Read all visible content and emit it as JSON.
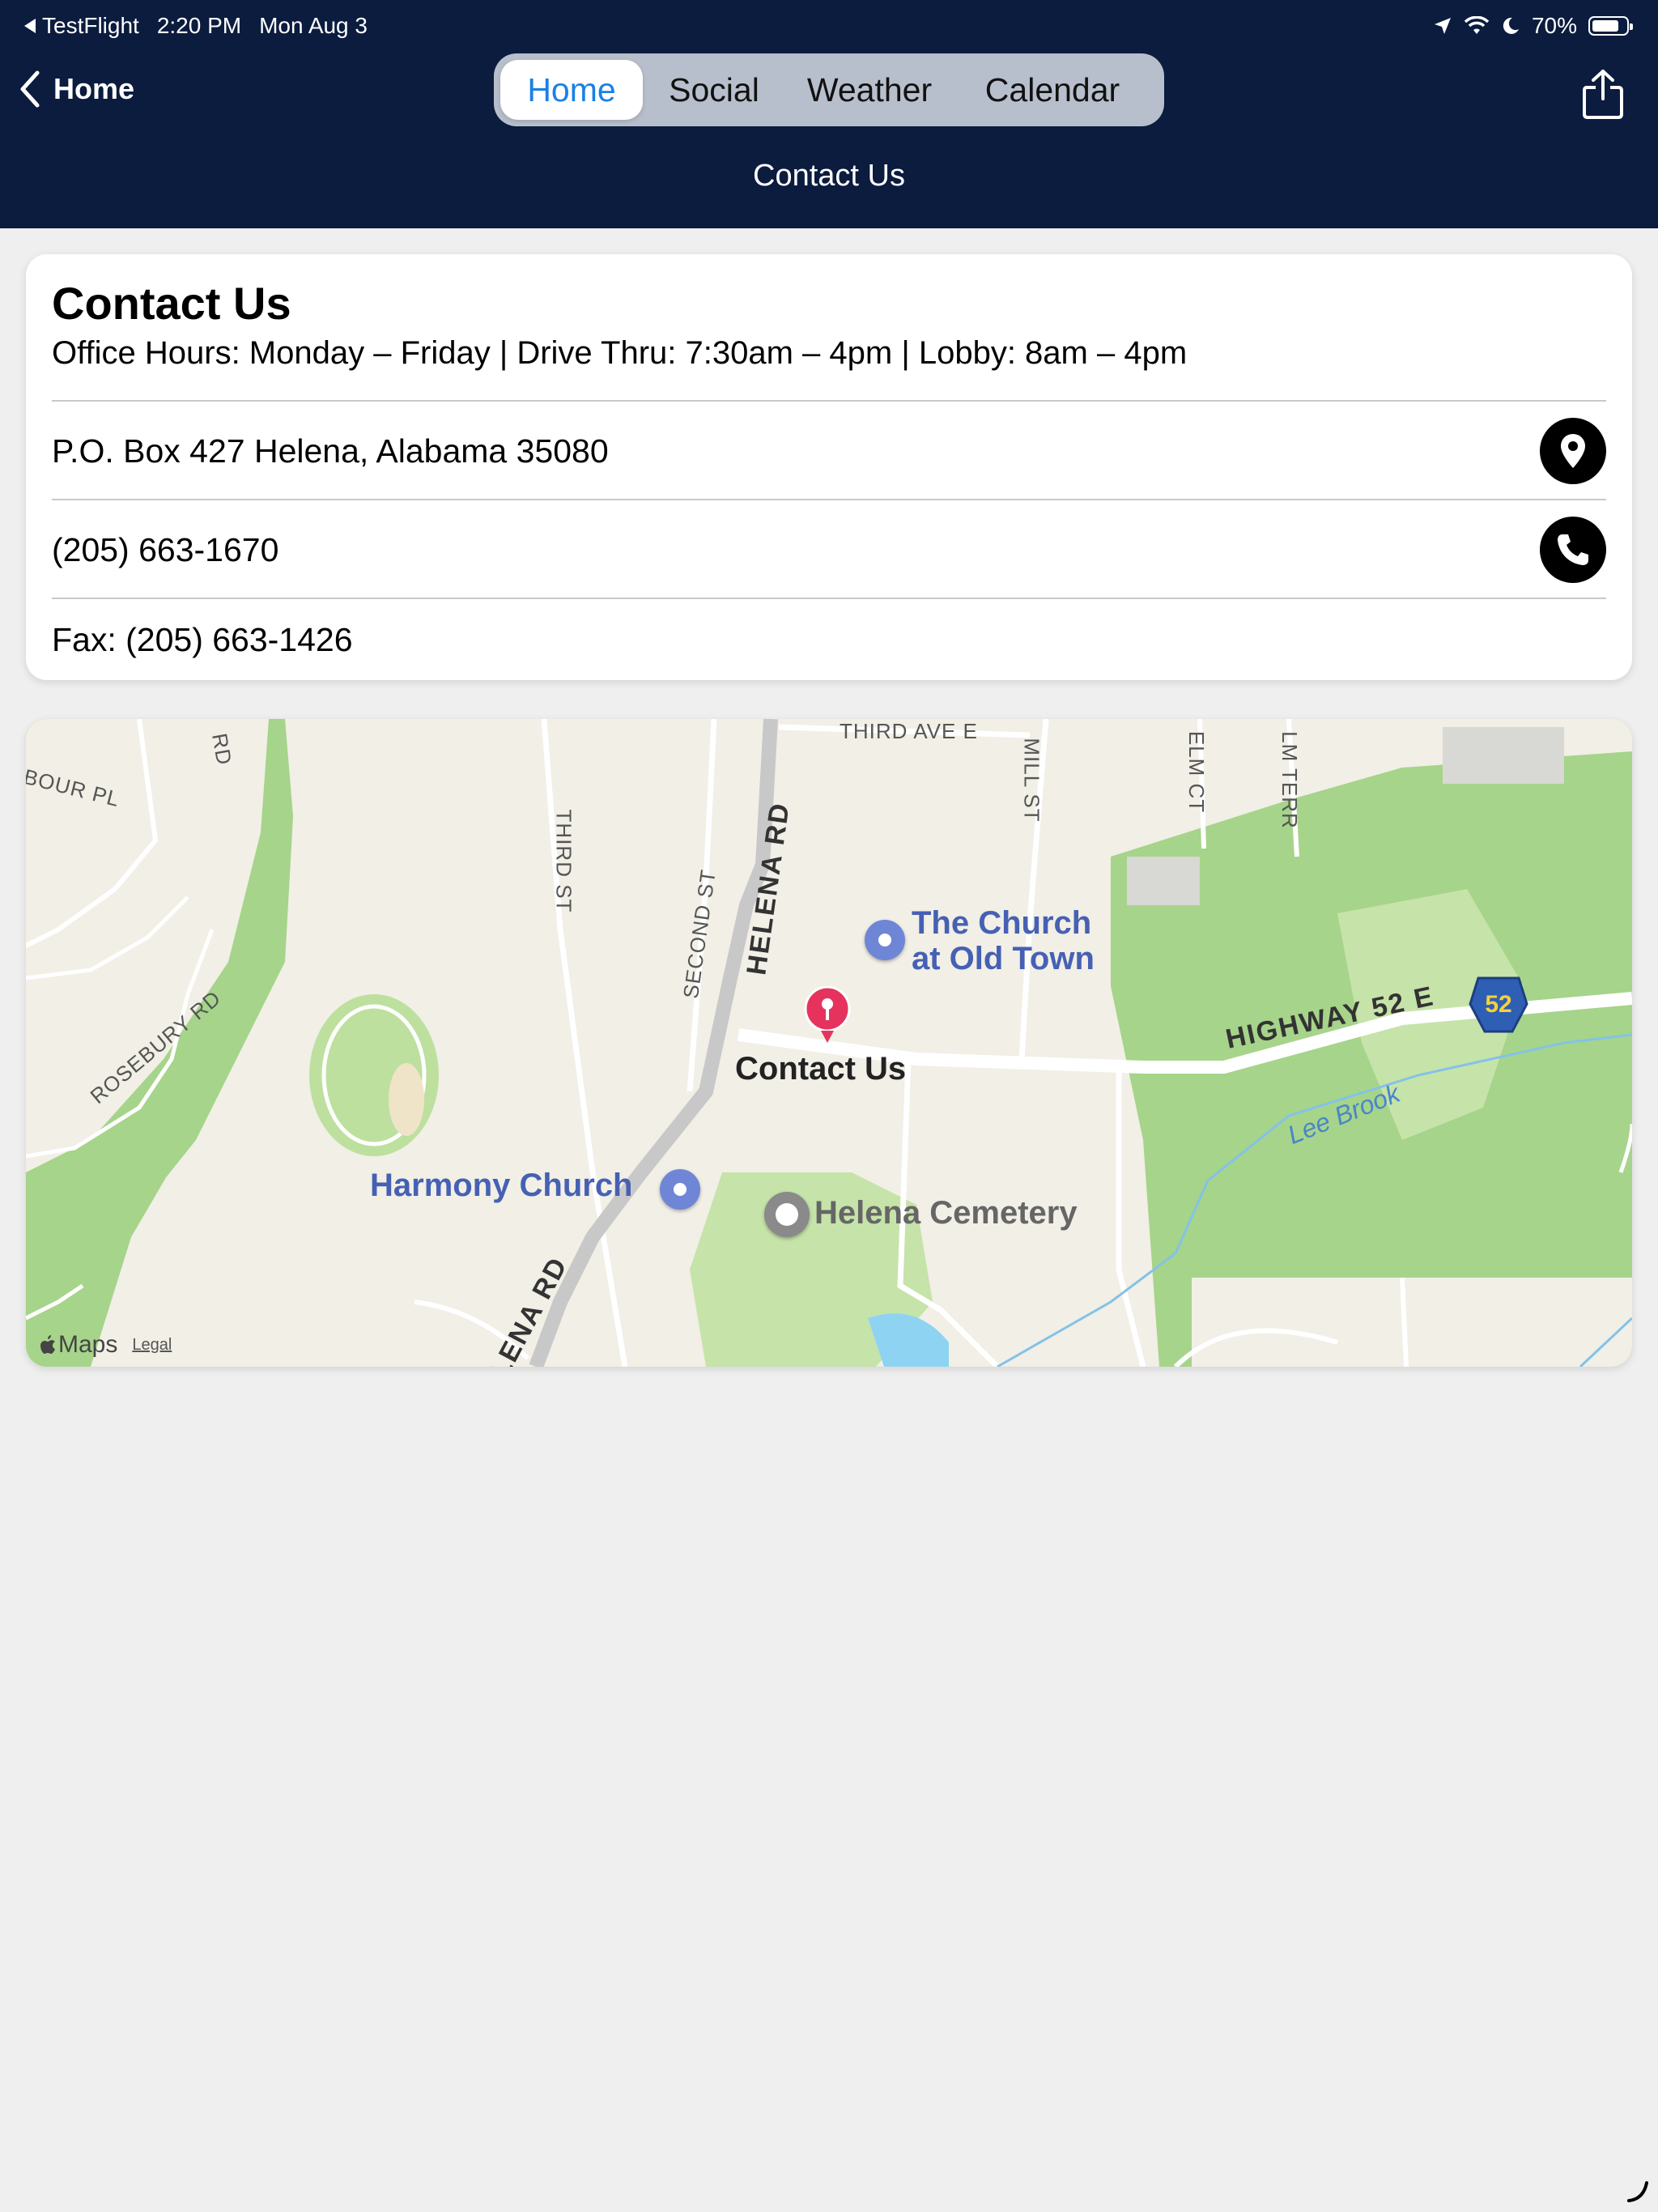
{
  "status_bar": {
    "back_app": "TestFlight",
    "time": "2:20 PM",
    "date": "Mon Aug 3",
    "battery": "70%"
  },
  "nav": {
    "back_label": "Home",
    "tabs": [
      {
        "label": "Home",
        "active": true
      },
      {
        "label": "Social",
        "active": false
      },
      {
        "label": "Weather",
        "active": false
      },
      {
        "label": "Calendar",
        "active": false
      }
    ],
    "title": "Contact Us"
  },
  "contact": {
    "heading": "Contact Us",
    "hours": "Office Hours: Monday – Friday | Drive Thru: 7:30am – 4pm | Lobby: 8am – 4pm",
    "address": "P.O. Box 427 Helena, Alabama 35080",
    "phone": "(205) 663-1670",
    "fax": "Fax: (205) 663-1426"
  },
  "map": {
    "streets": {
      "third_ave": "THIRD AVE E",
      "mill_st": "MILL ST",
      "elm_ct": "ELM CT",
      "elm_terr": "LM TERR",
      "bour_pl": "BOUR PL",
      "rd_top": "RD",
      "third_st": "THIRD ST",
      "second_st": "SECOND ST",
      "helena_rd_top": "HELENA RD",
      "helena_rd_bottom": "LENA RD",
      "rosebury_rd": "ROSEBURY RD",
      "highway": "HIGHWAY 52 E"
    },
    "route_shield": "52",
    "waterway": "Lee Brook",
    "pois": {
      "church_line1": "The Church",
      "church_line2": "at Old Town",
      "harmony": "Harmony Church",
      "cemetery": "Helena Cemetery",
      "pin_label": "Contact Us"
    },
    "attribution": "Maps",
    "legal": "Legal"
  },
  "colors": {
    "nav_bg": "#0b1c3e",
    "accent": "#1a80e6",
    "page_bg": "#efefef",
    "park_green": "#b5dc9a"
  }
}
